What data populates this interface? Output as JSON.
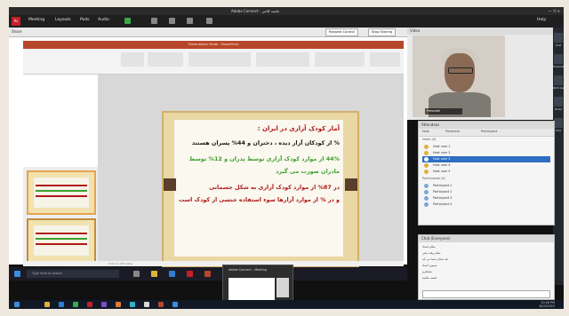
{
  "window": {
    "title": "Adobe Connect - جلسه کلاس",
    "controls": "—  ❐  ✕"
  },
  "menubar": {
    "logo": "Ac",
    "items": [
      "Meeting",
      "Layouts",
      "Pods",
      "Audio"
    ],
    "help": "Help"
  },
  "share_pod": {
    "title": "Share",
    "button_request": "Request Control",
    "button_stop": "Stop Sharing"
  },
  "powerpoint": {
    "title_bar": "Presentation Mode - PowerPoint"
  },
  "slide": {
    "heading": "آمار کودک آزاری در ایران :",
    "lines": [
      {
        "text": "% از کودکان آزار دیده ، دختران و 44% پسران هستند",
        "color": "#1a1a1a"
      },
      {
        "text": "44% از موارد کودک آزاری توسط پدران و 12% توسط",
        "color": "#3f9e2e"
      },
      {
        "text": "مادران صورت می گیرد",
        "color": "#3f9e2e"
      },
      {
        "text": "در 87% از موارد کودک آزاری به شکل جسمانی",
        "color": "#b01818"
      },
      {
        "text": "و در % از موارد آزارها سوء استفاده جنسی از کودک است",
        "color": "#b01818"
      }
    ],
    "heading_color": "#b01818"
  },
  "ppt_status": "Click to add notes",
  "taskbar": {
    "search_placeholder": "Type here to search",
    "popup_caption": "Adobe Connect - Meeting"
  },
  "clock": {
    "time": "10:26 PM",
    "date": "8/15/2020"
  },
  "video_pod": {
    "title": "Video",
    "presenter_name": "Presenter"
  },
  "side_icons": [
    "Chat",
    "Presenter",
    "Participant",
    "Notes",
    "Files"
  ],
  "attendees_pod": {
    "title": "Attendees",
    "tabs": [
      "Host",
      "Presenter",
      "Participant"
    ],
    "hosts_label": "Hosts (4)",
    "hosts": [
      "Host user 1",
      "Host user 2",
      "Host user 3",
      "Host user 4",
      "Host user 5"
    ],
    "participants_label": "Participants (4)",
    "participants": [
      "Participant 1",
      "Participant 2",
      "Participant 3",
      "Participant 4"
    ]
  },
  "chat_pod": {
    "title": "Chat (Everyone)",
    "messages": [
      "سلام استاد",
      "سلام وقت بخیر",
      "بله صدای شما می آید",
      "ممنون استاد",
      "متشکرم",
      "خسته نباشید"
    ]
  }
}
